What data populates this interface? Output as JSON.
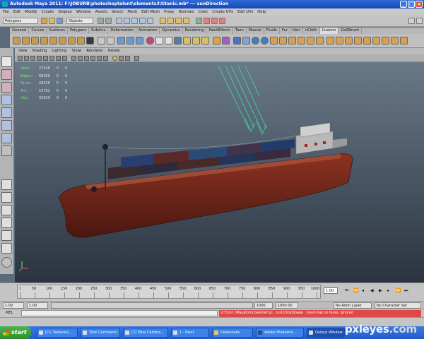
{
  "window": {
    "title": "Autodesk Maya 2011: F:\\JOBURB\\photoshoptalent\\elements3\\titanic.mb*  ---  sunDirection",
    "minimize": "_",
    "maximize": "□",
    "close": "×"
  },
  "menubar": [
    "File",
    "Edit",
    "Modify",
    "Create",
    "Display",
    "Window",
    "Assets",
    "Select",
    "Mesh",
    "Edit Mesh",
    "Proxy",
    "Normals",
    "Color",
    "Create UVs",
    "Edit UVs",
    "Help"
  ],
  "statusline": {
    "menu_set": "Polygons",
    "selection_mode": "Objects"
  },
  "shelf_tabs": [
    "General",
    "Curves",
    "Surfaces",
    "Polygons",
    "Subdivs",
    "Deformation",
    "Animation",
    "Dynamics",
    "Rendering",
    "PaintEffects",
    "Toon",
    "Muscle",
    "Fluids",
    "Fur",
    "Hair",
    "nCloth",
    "Custom",
    "GoZBrush"
  ],
  "shelf_active": "Custom",
  "panel_menu": [
    "View",
    "Shading",
    "Lighting",
    "Show",
    "Renderer",
    "Panels"
  ],
  "hud": [
    {
      "label": "Verts:",
      "a": "37546",
      "b": "0",
      "c": "0"
    },
    {
      "label": "Edges:",
      "a": "66366",
      "b": "0",
      "c": "0"
    },
    {
      "label": "Faces:",
      "a": "28236",
      "b": "0",
      "c": "0"
    },
    {
      "label": "Tris:",
      "a": "53782",
      "b": "0",
      "c": "0"
    },
    {
      "label": "UVs:",
      "a": "33900",
      "b": "0",
      "c": "0"
    }
  ],
  "time_slider": {
    "ticks": [
      "1",
      "50",
      "100",
      "150",
      "200",
      "250",
      "300",
      "350",
      "400",
      "450",
      "500",
      "550",
      "600",
      "650",
      "700",
      "750",
      "800",
      "850",
      "900",
      "950",
      "1000"
    ],
    "current_frame": "1.00"
  },
  "range_slider": {
    "start": "1.00",
    "inner_start": "1.00",
    "inner_end": "1000",
    "end": "1000.00",
    "anim_layer": "No Anim Layer",
    "character_set": "No Character Set"
  },
  "command_line": {
    "label": "MEL",
    "error": "// Error: (Mayatomr.Geometry) : rusticShipShape : mesh has no faces, ignored"
  },
  "taskbar": {
    "start": "start",
    "tasks": [
      "[CG Textures] ...",
      "Total Command...",
      "[2] Total Comma...",
      "1 - Paint",
      "Downloads",
      "Adobe Photosho...",
      "Output Window"
    ]
  },
  "watermark": {
    "main": "pxleyes",
    "tld": ".com"
  },
  "colors": {
    "hull": "#7a2a1c",
    "error_bg": "#e04848",
    "title_bar": "#1546b8",
    "light_lines": "#3fe0a0"
  }
}
